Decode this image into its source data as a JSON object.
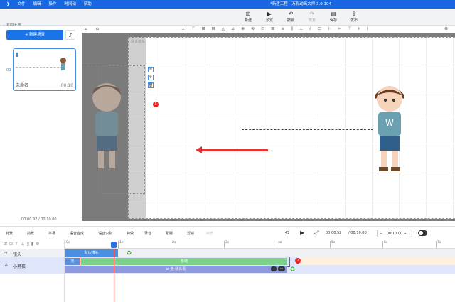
{
  "menu": [
    "文件",
    "编辑",
    "操作",
    "时间轴",
    "帮助"
  ],
  "title": "*新建工程 - 万彩动画大师 3.0.104",
  "back": "返回主页",
  "toolbar": [
    {
      "icon": "new-icon",
      "label": "新建"
    },
    {
      "icon": "play-icon",
      "label": "预览"
    },
    {
      "icon": "undo-icon",
      "label": "撤销"
    },
    {
      "icon": "redo-icon",
      "label": "恢复"
    },
    {
      "icon": "save-icon",
      "label": "保存"
    },
    {
      "icon": "publish-icon",
      "label": "发布"
    }
  ],
  "left": {
    "new_scene": "+ 新建场景",
    "scene": {
      "num": "01",
      "name": "未命名",
      "duration": "00:10"
    },
    "current": "00:00.92",
    "total": "/ 00:10.00"
  },
  "stage": {
    "camera_label": "默认镜头"
  },
  "timeline_tools": [
    "背景",
    "前景",
    "字幕",
    "语音合成",
    "语音识别",
    "特效",
    "录音",
    "蒙版",
    "滤镜",
    "对齐"
  ],
  "playback": {
    "current": "00:00.92",
    "total": "/ 00:10.00",
    "zoom": "00:10.00"
  },
  "ruler": [
    "0s",
    "1s",
    "2s",
    "3s",
    "4s",
    "5s",
    "6s",
    "7s"
  ],
  "tracks": [
    {
      "name": "镜头",
      "block": "默认镜头"
    },
    {
      "name": "小男孩",
      "enter": "无",
      "move": "移动",
      "action": "走-侧头看"
    }
  ],
  "badges": [
    "1",
    "2"
  ],
  "colors": {
    "accent": "#1a73e8",
    "move": "#7ed18a",
    "highlight": "#e83030"
  }
}
